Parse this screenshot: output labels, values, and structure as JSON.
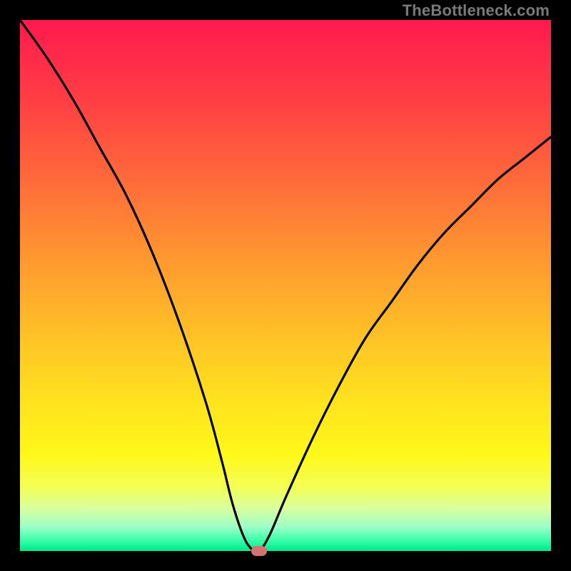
{
  "watermark": "TheBottleneck.com",
  "colors": {
    "black": "#000000",
    "curve": "#000000",
    "marker": "#d4736f",
    "gradient_stops": [
      {
        "offset": 0.0,
        "color": "#ff1a4e"
      },
      {
        "offset": 0.15,
        "color": "#ff3e44"
      },
      {
        "offset": 0.3,
        "color": "#ff6a3a"
      },
      {
        "offset": 0.45,
        "color": "#ff9830"
      },
      {
        "offset": 0.6,
        "color": "#ffc326"
      },
      {
        "offset": 0.72,
        "color": "#ffe31e"
      },
      {
        "offset": 0.82,
        "color": "#fff81a"
      },
      {
        "offset": 0.88,
        "color": "#f4ff55"
      },
      {
        "offset": 0.92,
        "color": "#d8ffa0"
      },
      {
        "offset": 0.955,
        "color": "#9cffc8"
      },
      {
        "offset": 0.975,
        "color": "#4cffb0"
      },
      {
        "offset": 0.99,
        "color": "#18f59a"
      },
      {
        "offset": 1.0,
        "color": "#00e889"
      }
    ]
  },
  "chart_data": {
    "type": "line",
    "title": "",
    "xlabel": "",
    "ylabel": "",
    "xlim": [
      0,
      100
    ],
    "ylim": [
      0,
      100
    ],
    "x": [
      0,
      5,
      10,
      15,
      20,
      25,
      30,
      35,
      38,
      40,
      42,
      43.5,
      45,
      47,
      50,
      55,
      60,
      65,
      70,
      75,
      80,
      85,
      90,
      95,
      100
    ],
    "values": [
      100,
      93,
      85,
      76,
      67,
      56,
      43,
      28,
      17,
      9,
      3,
      0.5,
      0,
      3,
      10,
      21,
      31,
      40,
      47,
      54,
      60,
      65,
      70,
      74,
      78
    ],
    "marker": {
      "x": 45,
      "y": 0
    }
  }
}
